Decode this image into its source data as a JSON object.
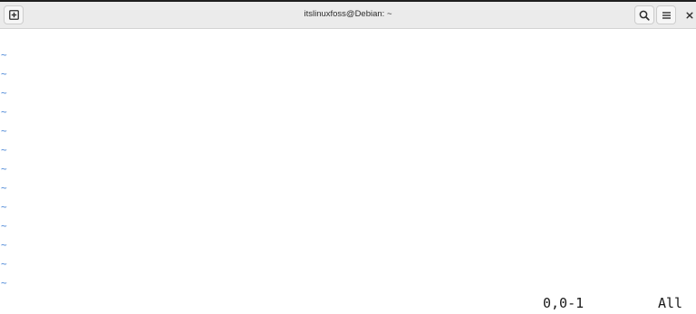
{
  "window": {
    "title": "itslinuxfoss@Debian: ~",
    "icons": {
      "new_tab": "new-tab-icon",
      "search": "search-icon",
      "menu": "hamburger-menu-icon",
      "close": "close-icon"
    }
  },
  "editor": {
    "empty_line_marker": "~",
    "empty_lines": [
      "~",
      "~",
      "~",
      "~",
      "~",
      "~",
      "~",
      "~",
      "~",
      "~",
      "~",
      "~",
      "~"
    ],
    "status": {
      "cursor_position": "0,0-1",
      "scroll_position": "All"
    }
  },
  "colors": {
    "titlebar_bg": "#ebebeb",
    "terminal_bg": "#ffffff",
    "tilde": "#4a86d6",
    "text": "#1a1a1a"
  }
}
